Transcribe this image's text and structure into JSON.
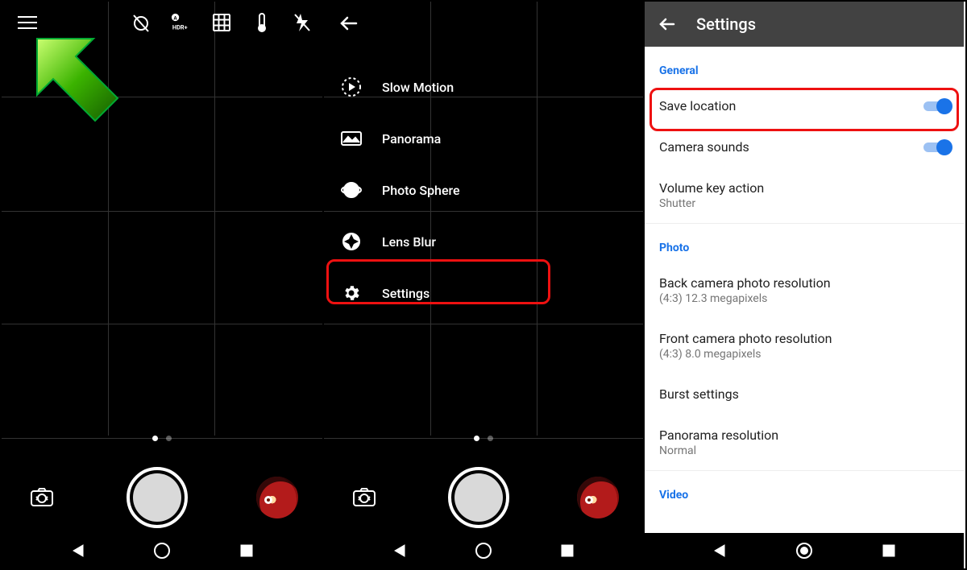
{
  "pane2": {
    "menu": [
      "Slow Motion",
      "Panorama",
      "Photo Sphere",
      "Lens Blur",
      "Settings"
    ]
  },
  "pane3": {
    "title": "Settings",
    "sections": {
      "general": {
        "label": "General",
        "save_location": "Save location",
        "camera_sounds": "Camera sounds",
        "volume_key_action": {
          "title": "Volume key action",
          "sub": "Shutter"
        }
      },
      "photo": {
        "label": "Photo",
        "back_res": {
          "title": "Back camera photo resolution",
          "sub": "(4:3) 12.3 megapixels"
        },
        "front_res": {
          "title": "Front camera photo resolution",
          "sub": "(4:3) 8.0 megapixels"
        },
        "burst": "Burst settings",
        "pano": {
          "title": "Panorama resolution",
          "sub": "Normal"
        }
      },
      "video": {
        "label": "Video"
      }
    }
  }
}
